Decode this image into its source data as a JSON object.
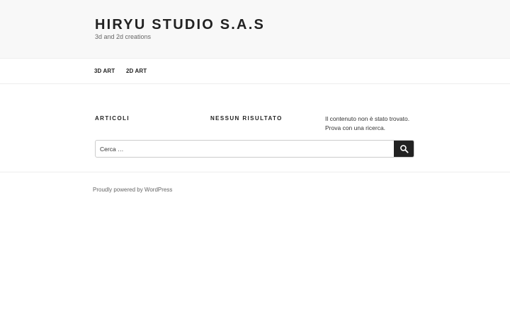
{
  "header": {
    "site_title": "HIRYU STUDIO S.A.S",
    "tagline": "3d and 2d creations"
  },
  "nav": {
    "items": [
      {
        "label": "3D ART"
      },
      {
        "label": "2D ART"
      }
    ]
  },
  "content": {
    "articles_heading": "ARTICOLI",
    "no_results_heading": "NESSUN RISULTATO",
    "message": "Il contenuto non è stato trovato. Prova con una ricerca."
  },
  "search": {
    "placeholder": "Cerca …",
    "icon": "search-icon"
  },
  "footer": {
    "powered_by": "Proudly powered by WordPress"
  },
  "colors": {
    "header_bg": "#f8f8f8",
    "search_button_bg": "#222222"
  }
}
